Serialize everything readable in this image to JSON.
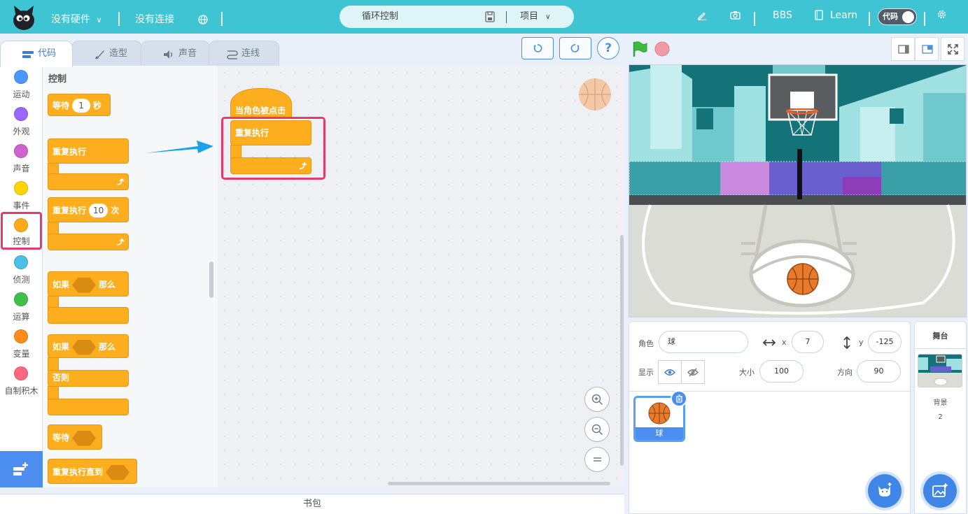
{
  "topbar": {
    "hardware": "没有硬件",
    "connection": "没有连接",
    "project_name": "循环控制",
    "project_menu": "项目",
    "bbs": "BBS",
    "learn": "Learn",
    "code_toggle": "代码"
  },
  "tabs": [
    {
      "label": "代码",
      "icon": "code-icon"
    },
    {
      "label": "造型",
      "icon": "brush-icon"
    },
    {
      "label": "声音",
      "icon": "sound-icon"
    },
    {
      "label": "连线",
      "icon": "wire-icon"
    }
  ],
  "controls": {
    "help": "?"
  },
  "categories": [
    {
      "label": "运动",
      "color": "#4c97ff"
    },
    {
      "label": "外观",
      "color": "#9966ff"
    },
    {
      "label": "声音",
      "color": "#cf63cf"
    },
    {
      "label": "事件",
      "color": "#ffd500"
    },
    {
      "label": "控制",
      "color": "#ffab19"
    },
    {
      "label": "侦测",
      "color": "#4cbfe6"
    },
    {
      "label": "运算",
      "color": "#40bf4a"
    },
    {
      "label": "变量",
      "color": "#ff8c1a"
    },
    {
      "label": "自制积木",
      "color": "#ff6680"
    }
  ],
  "palette": {
    "title": "控制",
    "wait_label": "等待",
    "wait_value": "1",
    "wait_unit": "秒",
    "forever": "重复执行",
    "repeat_label": "重复执行",
    "repeat_value": "10",
    "repeat_unit": "次",
    "if_label": "如果",
    "then_label": "那么",
    "else_label": "否则",
    "wait_until": "等待",
    "repeat_until": "重复执行直到"
  },
  "workspace": {
    "hat_block": "当角色被点击",
    "forever_block": "重复执行"
  },
  "backpack": "书包",
  "sprite": {
    "role_label": "角色",
    "role_name": "球",
    "x_label": "x",
    "x_value": "7",
    "y_label": "y",
    "y_value": "-125",
    "show_label": "显示",
    "size_label": "大小",
    "size_value": "100",
    "direction_label": "方向",
    "direction_value": "90",
    "tile_name": "球"
  },
  "stage_panel": {
    "title": "舞台",
    "backdrop_label": "背景",
    "backdrop_count": "2"
  },
  "colors": {
    "topbar": "#3fc4d4",
    "accent": "#4c8ef0",
    "control_block": "#fdae1e",
    "highlight": "#e33b6e"
  }
}
